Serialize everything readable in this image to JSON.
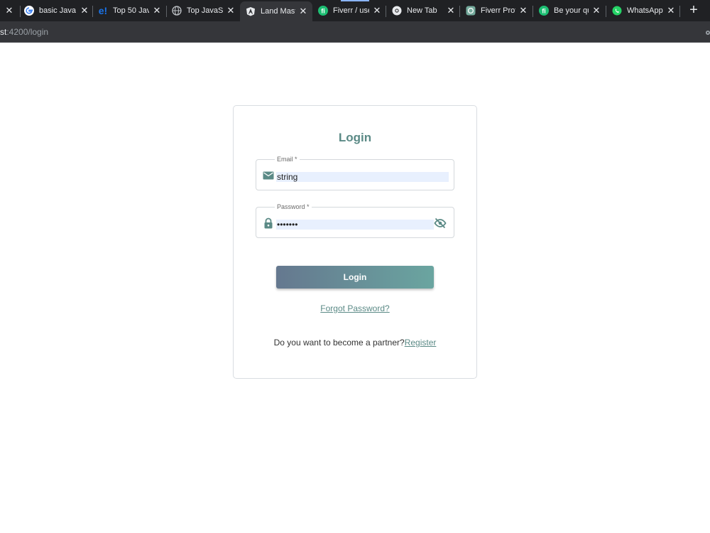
{
  "browser": {
    "tabs": [
      {
        "title": "",
        "favicon": "close-icon"
      },
      {
        "title": "basic Java",
        "favicon": "google-icon"
      },
      {
        "title": "Top 50 Jav",
        "favicon": "edureka-icon"
      },
      {
        "title": "Top JavaSc",
        "favicon": "globe-icon"
      },
      {
        "title": "Land Mast",
        "favicon": "angular-icon",
        "active": true
      },
      {
        "title": "Fiverr / use",
        "favicon": "fiverr-icon"
      },
      {
        "title": "New Tab",
        "favicon": "chrome-icon"
      },
      {
        "title": "Fiverr Prof",
        "favicon": "chatgpt-icon"
      },
      {
        "title": "Be your qu",
        "favicon": "fiverr-icon"
      },
      {
        "title": "WhatsApp",
        "favicon": "whatsapp-icon"
      }
    ],
    "url_host": "st",
    "url_rest": ":4200/login"
  },
  "login": {
    "title": "Login",
    "email_label": "Email *",
    "email_value": "string",
    "password_label": "Password *",
    "password_value": "•••••••",
    "login_button": "Login",
    "forgot_link": "Forgot Password?",
    "partner_text": "Do you want to become a partner?",
    "register_link": "Register"
  },
  "colors": {
    "accent": "#5b8a86",
    "button_start": "#65788f",
    "button_end": "#6aa5a0",
    "autofill_bg": "#e8f0fe"
  }
}
